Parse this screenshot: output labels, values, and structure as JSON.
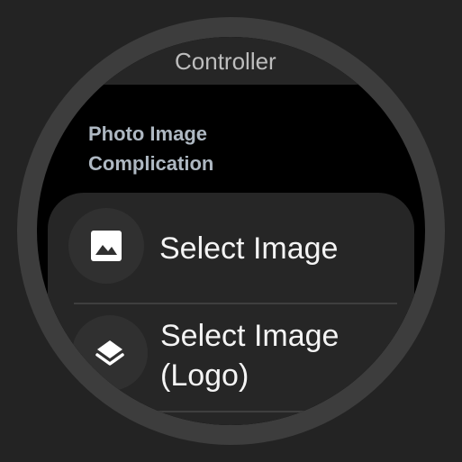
{
  "header": {
    "chip_label": "Controller",
    "chip_icon": "app-icon"
  },
  "section": {
    "title": "Photo Image Complication"
  },
  "items": [
    {
      "label": "Select Image",
      "icon": "image-icon"
    },
    {
      "label": "Select Image (Logo)",
      "icon": "layers-icon"
    }
  ],
  "colors": {
    "background": "#232323",
    "bezel": "#3d3d3d",
    "screen": "#000000",
    "card": "#262626",
    "title_text": "#aeb8c2",
    "item_text": "#f4f4f4"
  }
}
